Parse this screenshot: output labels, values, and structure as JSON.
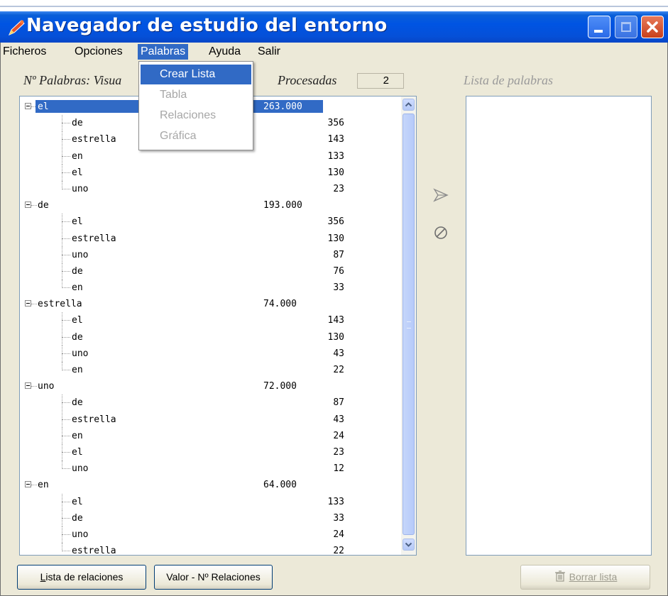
{
  "window": {
    "title": "Navegador de estudio del entorno",
    "accent_color": "#0054e3",
    "selection_color": "#316ac5"
  },
  "menu": {
    "items": [
      "Ficheros",
      "Opciones",
      "Palabras",
      "Ayuda",
      "Salir"
    ],
    "open_menu": "Palabras",
    "dropdown": [
      "Crear Lista",
      "Tabla",
      "Relaciones",
      "Gráfica"
    ]
  },
  "header": {
    "words_label": "Nº Palabras: Visua",
    "processed_label": "Procesadas",
    "processed_value": "2",
    "list_label": "Lista de palabras"
  },
  "tree": [
    {
      "word": "el",
      "count": "263.000",
      "selected": true,
      "children": [
        {
          "word": "de",
          "count": "356"
        },
        {
          "word": "estrella",
          "count": "143"
        },
        {
          "word": "en",
          "count": "133"
        },
        {
          "word": "el",
          "count": "130"
        },
        {
          "word": "uno",
          "count": "23"
        }
      ]
    },
    {
      "word": "de",
      "count": "193.000",
      "children": [
        {
          "word": "el",
          "count": "356"
        },
        {
          "word": "estrella",
          "count": "130"
        },
        {
          "word": "uno",
          "count": "87"
        },
        {
          "word": "de",
          "count": "76"
        },
        {
          "word": "en",
          "count": "33"
        }
      ]
    },
    {
      "word": "estrella",
      "count": "74.000",
      "children": [
        {
          "word": "el",
          "count": "143"
        },
        {
          "word": "de",
          "count": "130"
        },
        {
          "word": "uno",
          "count": "43"
        },
        {
          "word": "en",
          "count": "22"
        }
      ]
    },
    {
      "word": "uno",
      "count": "72.000",
      "children": [
        {
          "word": "de",
          "count": "87"
        },
        {
          "word": "estrella",
          "count": "43"
        },
        {
          "word": "en",
          "count": "24"
        },
        {
          "word": "el",
          "count": "23"
        },
        {
          "word": "uno",
          "count": "12"
        }
      ]
    },
    {
      "word": "en",
      "count": "64.000",
      "children": [
        {
          "word": "el",
          "count": "133"
        },
        {
          "word": "de",
          "count": "33"
        },
        {
          "word": "uno",
          "count": "24"
        },
        {
          "word": "estrella",
          "count": "22"
        }
      ]
    }
  ],
  "buttons": {
    "relations_list": "Lista de relaciones",
    "relations_value": "Valor - Nº Relaciones",
    "clear_list": "Borrar lista"
  }
}
